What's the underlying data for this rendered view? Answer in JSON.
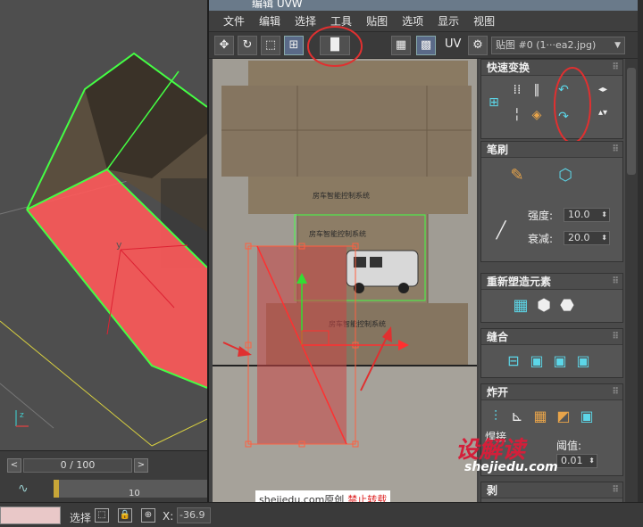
{
  "window": {
    "title": "编辑 UVW"
  },
  "menu": [
    "文件",
    "编辑",
    "选择",
    "工具",
    "贴图",
    "选项",
    "显示",
    "视图"
  ],
  "toolbar": {
    "icons": [
      "move-icon",
      "rotate-icon",
      "scale-icon",
      "freeform-icon",
      "mirror-icon",
      "checker-icon",
      "grid-icon"
    ],
    "uv_label": "UV",
    "map_dropdown": "贴图 #0 (1···ea2.jpg)"
  },
  "timeline": {
    "frame_display": "0 / 100",
    "tick_label": "10"
  },
  "statusbar": {
    "selection_label": "选择",
    "x_label": "X:",
    "x_value": "-36.9"
  },
  "panel": {
    "quick_transform": {
      "title": "快速变换"
    },
    "brush": {
      "title": "笔刷",
      "strength_label": "强度:",
      "strength_value": "10.0",
      "falloff_label": "衰减:",
      "falloff_value": "20.0"
    },
    "reshape": {
      "title": "重新塑造元素"
    },
    "stitch": {
      "title": "缝合"
    },
    "explode": {
      "title": "炸开",
      "weld_label": "焊接",
      "threshold_label": "阈值:",
      "threshold_value": "0.01"
    },
    "peel": {
      "title": "剥"
    }
  },
  "uv_texture": {
    "title_text_1": "房车智能控制系统",
    "title_text_2": "房车智能控制系统",
    "title_text_3": "房车智能控制系统"
  },
  "watermark": {
    "site": "shejiedu.com原创",
    "warning": "禁止转载"
  },
  "brand": {
    "logo": "设解读",
    "url": "shejiedu.com"
  },
  "colors": {
    "selection_red": "#ff5050",
    "edge_green": "#44ff44",
    "annotation_red": "#e03030",
    "cardboard": "#8a7a62"
  }
}
